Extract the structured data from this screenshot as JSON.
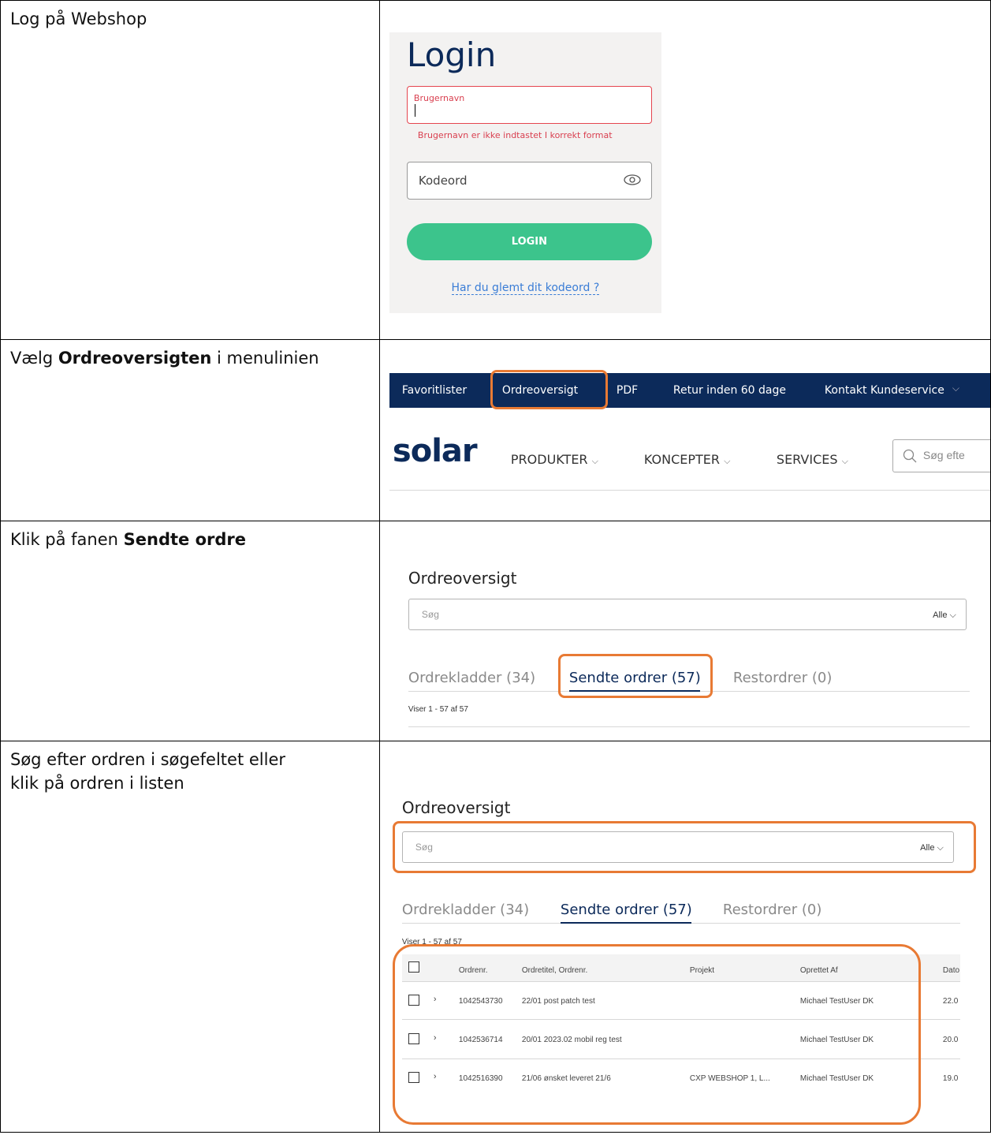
{
  "steps": [
    {
      "instruction": "Log på Webshop"
    },
    {
      "pre": "Vælg ",
      "bold": "Ordreoversigten",
      "post": " i menulinien"
    },
    {
      "pre": "Klik på fanen ",
      "bold": "Sendte ordre",
      "post": ""
    },
    {
      "instruction": "Søg efter ordren i søgefeltet eller klik på ordren i listen"
    }
  ],
  "login": {
    "title": "Login",
    "username_label": "Brugernavn",
    "username_error": "Brugernavn er ikke indtastet I korrekt format",
    "password_placeholder": "Kodeord",
    "button_label": "LOGIN",
    "forgot_link": "Har du glemt dit kodeord ?"
  },
  "nav": {
    "top_items": [
      "Favoritlister",
      "Ordreoversigt",
      "PDF",
      "Retur inden 60 dage",
      "Kontakt Kundeservice"
    ],
    "logo": "solar",
    "main_items": [
      "PRODUKTER",
      "KONCEPTER",
      "SERVICES"
    ],
    "search_placeholder": "Søg efte"
  },
  "overview": {
    "title": "Ordreoversigt",
    "search_placeholder": "Søg",
    "filter_label": "Alle",
    "tabs": [
      "Ordrekladder (34)",
      "Sendte ordrer (57)",
      "Restordrer (0)"
    ],
    "count_text": "Viser 1 - 57 af 57"
  },
  "table": {
    "headers": [
      "Ordrenr.",
      "Ordretitel, Ordrenr.",
      "Projekt",
      "Oprettet Af",
      "Dato"
    ],
    "rows": [
      {
        "ordrenr": "1042543730",
        "titel": "22/01 post patch test",
        "projekt": "",
        "oprettet": "Michael TestUser DK",
        "dato": "22.0"
      },
      {
        "ordrenr": "1042536714",
        "titel": "20/01 2023.02 mobil reg test",
        "projekt": "",
        "oprettet": "Michael TestUser DK",
        "dato": "20.0"
      },
      {
        "ordrenr": "1042516390",
        "titel": "21/06 ønsket leveret 21/6",
        "projekt": "CXP WEBSHOP 1, L...",
        "oprettet": "Michael TestUser DK",
        "dato": "19.0"
      }
    ]
  },
  "colors": {
    "highlight": "#e87a34",
    "navy": "#0c2a5a",
    "green": "#3cc48c",
    "error": "#d94050"
  }
}
